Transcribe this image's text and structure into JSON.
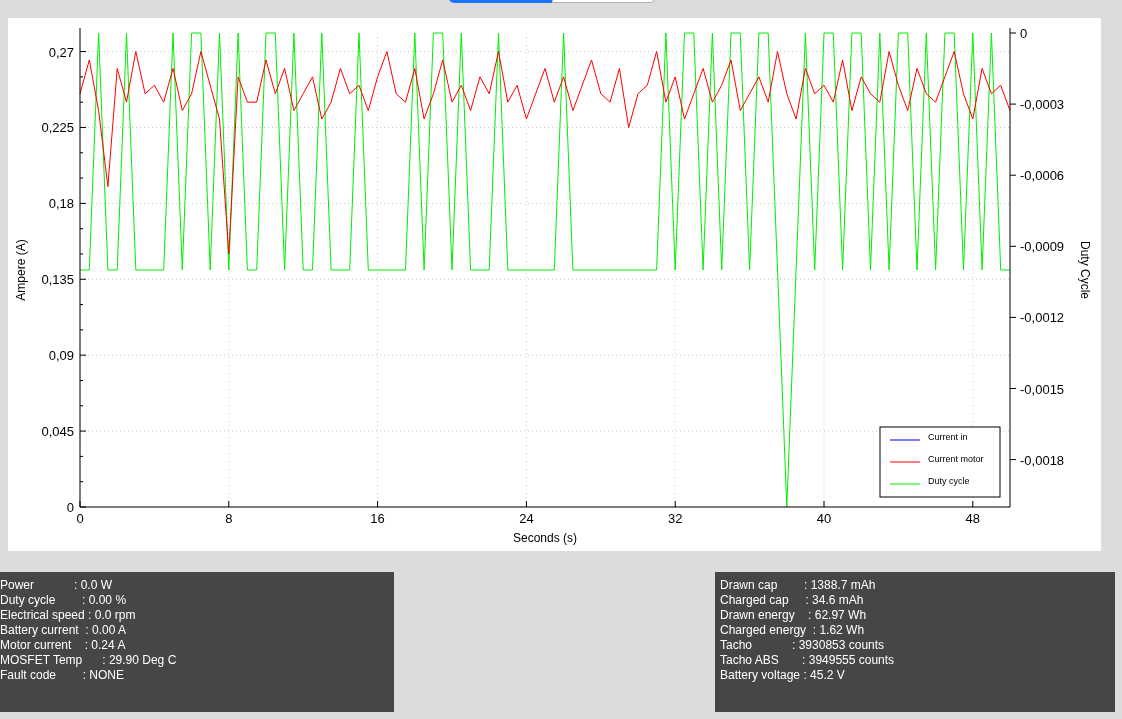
{
  "segmented_control": {
    "segments": [
      {
        "selected": true
      },
      {
        "selected": false
      }
    ]
  },
  "chart": {
    "chart_data": {
      "type": "line",
      "xlabel": "Seconds (s)",
      "ylabel": "Ampere (A)",
      "y2label": "Duty Cycle",
      "x": [
        0,
        0.5,
        1,
        1.5,
        2,
        2.5,
        3,
        3.5,
        4,
        4.5,
        5,
        5.5,
        6,
        6.5,
        7,
        7.5,
        8,
        8.5,
        9,
        9.5,
        10,
        10.5,
        11,
        11.5,
        12,
        12.5,
        13,
        13.5,
        14,
        14.5,
        15,
        15.5,
        16,
        16.5,
        17,
        17.5,
        18,
        18.5,
        19,
        19.5,
        20,
        20.5,
        21,
        21.5,
        22,
        22.5,
        23,
        23.5,
        24,
        24.5,
        25,
        25.5,
        26,
        26.5,
        27,
        27.5,
        28,
        28.5,
        29,
        29.5,
        30,
        30.5,
        31,
        31.5,
        32,
        32.5,
        33,
        33.5,
        34,
        34.5,
        35,
        35.5,
        36,
        36.5,
        37,
        37.5,
        38,
        38.5,
        39,
        39.5,
        40,
        40.5,
        41,
        41.5,
        42,
        42.5,
        43,
        43.5,
        44,
        44.5,
        45,
        45.5,
        46,
        46.5,
        47,
        47.5,
        48,
        48.5,
        49,
        49.5,
        50
      ],
      "xlim": [
        0,
        50
      ],
      "ylim": [
        0,
        0.281
      ],
      "y2lim": [
        -0.002,
        0
      ],
      "grid": true,
      "legend": true,
      "xticks": [
        0,
        8,
        16,
        24,
        32,
        40,
        48
      ],
      "yticks": [
        {
          "value": 0,
          "label": "0"
        },
        {
          "value": 0.045,
          "label": "0,045"
        },
        {
          "value": 0.09,
          "label": "0,09"
        },
        {
          "value": 0.135,
          "label": "0,135"
        },
        {
          "value": 0.18,
          "label": "0,18"
        },
        {
          "value": 0.225,
          "label": "0,225"
        },
        {
          "value": 0.27,
          "label": "0,27"
        }
      ],
      "y2ticks": [
        {
          "value": 0,
          "label": "0"
        },
        {
          "value": -0.0003,
          "label": "-0,0003"
        },
        {
          "value": -0.0006,
          "label": "-0,0006"
        },
        {
          "value": -0.0009,
          "label": "-0,0009"
        },
        {
          "value": -0.0012,
          "label": "-0,0012"
        },
        {
          "value": -0.0015,
          "label": "-0,0015"
        },
        {
          "value": -0.0018,
          "label": "-0,0018"
        }
      ],
      "series": [
        {
          "name": "Current in",
          "color": "#0000ff",
          "values": [
            null,
            null,
            null,
            null,
            null,
            null,
            null,
            null,
            null,
            null,
            null,
            null,
            null,
            null,
            null,
            null,
            null,
            null,
            null,
            null,
            null,
            null,
            null,
            null,
            null,
            null,
            null,
            null,
            null,
            null,
            null,
            null,
            null,
            null,
            null,
            null,
            null,
            null,
            null,
            null,
            null,
            null,
            null,
            null,
            null,
            null,
            null,
            null,
            null,
            null,
            null,
            null,
            null,
            null,
            null,
            null,
            null,
            null,
            null,
            null,
            null,
            null,
            null,
            null,
            null,
            null,
            null,
            null,
            null,
            null,
            null,
            null,
            null,
            null,
            null,
            null,
            null,
            null,
            null,
            null,
            null,
            null,
            null,
            null,
            null,
            null,
            null,
            null,
            null,
            null,
            null,
            null,
            null,
            null,
            null,
            null,
            null,
            null,
            null,
            null,
            null
          ]
        },
        {
          "name": "Current motor",
          "color": "#ff0000",
          "values": [
            0.245,
            0.265,
            0.235,
            0.19,
            0.26,
            0.24,
            0.27,
            0.245,
            0.25,
            0.24,
            0.26,
            0.235,
            0.245,
            0.27,
            0.25,
            0.23,
            0.15,
            0.255,
            0.24,
            0.24,
            0.265,
            0.245,
            0.26,
            0.235,
            0.245,
            0.255,
            0.23,
            0.24,
            0.26,
            0.245,
            0.25,
            0.235,
            0.255,
            0.27,
            0.245,
            0.24,
            0.26,
            0.23,
            0.245,
            0.265,
            0.24,
            0.25,
            0.235,
            0.255,
            0.245,
            0.27,
            0.24,
            0.25,
            0.23,
            0.245,
            0.26,
            0.24,
            0.255,
            0.235,
            0.25,
            0.265,
            0.245,
            0.24,
            0.26,
            0.225,
            0.245,
            0.25,
            0.27,
            0.24,
            0.255,
            0.23,
            0.245,
            0.26,
            0.24,
            0.25,
            0.265,
            0.235,
            0.245,
            0.255,
            0.24,
            0.27,
            0.245,
            0.23,
            0.26,
            0.245,
            0.25,
            0.24,
            0.265,
            0.235,
            0.255,
            0.245,
            0.24,
            0.27,
            0.25,
            0.235,
            0.26,
            0.245,
            0.24,
            0.255,
            0.27,
            0.245,
            0.23,
            0.26,
            0.245,
            0.25,
            0.235
          ]
        },
        {
          "name": "Duty cycle",
          "color": "#00ee00",
          "axis": "y2",
          "values": [
            -0.001,
            -0.001,
            0,
            -0.001,
            -0.001,
            0,
            -0.001,
            -0.001,
            -0.001,
            -0.001,
            0,
            -0.001,
            0,
            0,
            -0.001,
            0,
            -0.001,
            0,
            -0.001,
            -0.001,
            0,
            0,
            -0.001,
            0,
            -0.001,
            -0.001,
            0,
            -0.001,
            -0.001,
            -0.001,
            0,
            -0.001,
            -0.001,
            -0.001,
            -0.001,
            -0.001,
            0,
            -0.001,
            0,
            0,
            -0.001,
            0,
            -0.001,
            -0.001,
            -0.001,
            0,
            -0.001,
            -0.001,
            -0.001,
            -0.001,
            -0.001,
            -0.001,
            0,
            -0.001,
            -0.001,
            -0.001,
            -0.001,
            -0.001,
            -0.001,
            -0.001,
            -0.001,
            -0.001,
            -0.001,
            0,
            -0.001,
            0,
            0,
            -0.001,
            0,
            -0.001,
            0,
            0,
            -0.001,
            0,
            0,
            -0.001,
            -0.002,
            -0.001,
            0,
            -0.001,
            0,
            0,
            -0.001,
            0,
            0,
            -0.001,
            0,
            -0.001,
            0,
            0,
            -0.001,
            0,
            -0.001,
            0,
            0,
            -0.001,
            0,
            -0.001,
            0,
            -0.001,
            -0.001
          ]
        }
      ]
    }
  },
  "left_panel": {
    "lines": [
      "Power            : 0.0 W",
      "Duty cycle        : 0.00 %",
      "Electrical speed : 0.0 rpm",
      "Battery current  : 0.00 A",
      "Motor current    : 0.24 A",
      "MOSFET Temp      : 29.90 Deg C",
      "Fault code        : NONE"
    ]
  },
  "right_panel": {
    "lines": [
      "Drawn cap        : 1388.7 mAh",
      "Charged cap     : 34.6 mAh",
      "Drawn energy    : 62.97 Wh",
      "Charged energy  : 1.62 Wh",
      "Tacho            : 3930853 counts",
      "Tacho ABS       : 3949555 counts",
      "Battery voltage : 45.2 V"
    ]
  }
}
